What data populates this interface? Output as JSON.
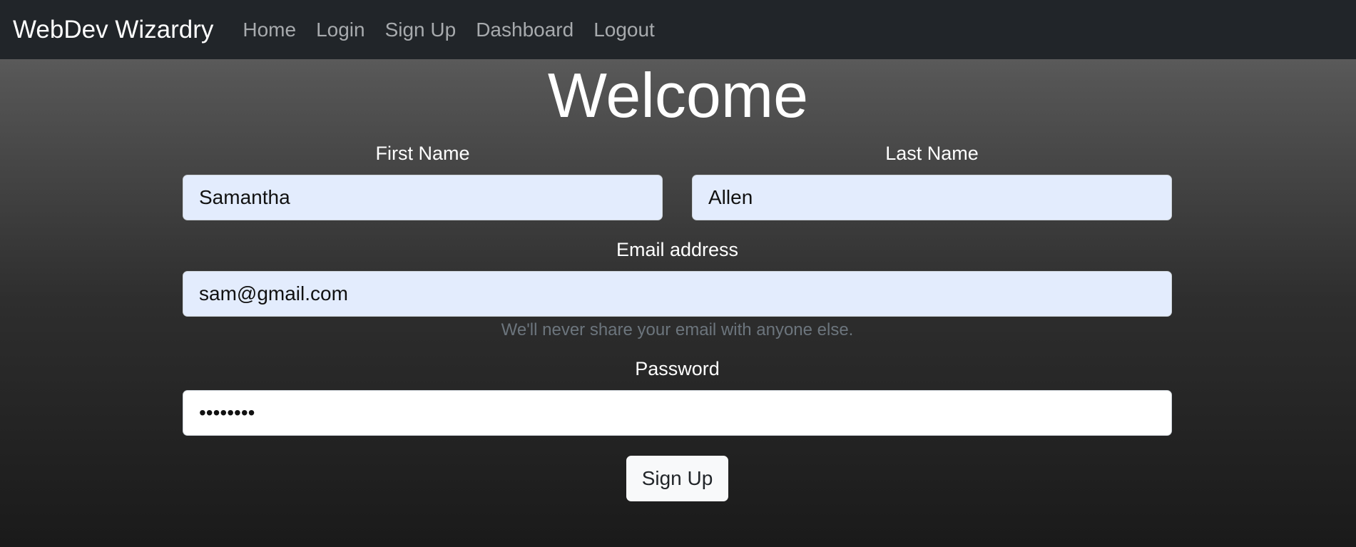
{
  "navbar": {
    "brand": "WebDev Wizardry",
    "links": [
      "Home",
      "Login",
      "Sign Up",
      "Dashboard",
      "Logout"
    ]
  },
  "page": {
    "title": "Welcome"
  },
  "form": {
    "first_name": {
      "label": "First Name",
      "value": "Samantha"
    },
    "last_name": {
      "label": "Last Name",
      "value": "Allen"
    },
    "email": {
      "label": "Email address",
      "value": "sam@gmail.com",
      "help": "We'll never share your email with anyone else."
    },
    "password": {
      "label": "Password",
      "value": "••••••••"
    },
    "submit_label": "Sign Up"
  },
  "colors": {
    "navbar_bg": "#212529",
    "autofill_bg": "#e3ecfd",
    "muted_text": "#6c757d",
    "button_bg": "#f8f9fa"
  }
}
